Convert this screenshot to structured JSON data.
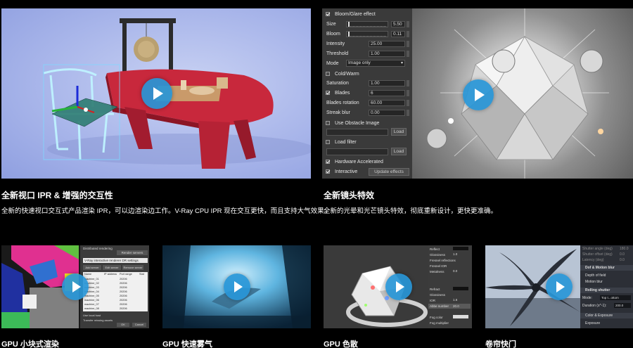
{
  "features": [
    {
      "title": "全新视口 IPR & 增强的交互性",
      "description": "全新的快速视口交互式产品渲染 IPR，可以边渲染边工作。V-Ray CPU IPR 现在交互更快，而且支持大气效果。"
    },
    {
      "title": "全新镜头特效",
      "description": "全新的光晕和光芒镜头特效，彻底重新设计，更快更准确。"
    },
    {
      "title": "GPU 小块式渲染"
    },
    {
      "title": "GPU 快速雾气"
    },
    {
      "title": "GPU 色散"
    },
    {
      "title": "卷帘快门"
    }
  ],
  "lens_panel": {
    "bloom_glare_label": "Bloom/Glare effect",
    "bloom_glare_checked": true,
    "size_label": "Size",
    "size_value": "5.50",
    "bloom_label": "Bloom",
    "bloom_value": "0.11",
    "intensity_label": "Intensity",
    "intensity_value": "25.00",
    "threshold_label": "Threshold",
    "threshold_value": "1.00",
    "mode_label": "Mode",
    "mode_value": "Image only",
    "cold_warm_label": "Cold/Warm",
    "cold_warm_checked": false,
    "saturation_label": "Saturation",
    "saturation_value": "1.00",
    "blades_label": "Blades",
    "blades_checked": true,
    "blades_value": "6",
    "blades_rotation_label": "Blades rotation",
    "blades_rotation_value": "60.00",
    "streak_blur_label": "Streak blur",
    "streak_blur_value": "0.00",
    "use_obstacle_label": "Use Obstacle Image",
    "use_obstacle_checked": false,
    "load_label": "Load",
    "load_filter_label": "Load filter",
    "load_filter_checked": false,
    "load_label_2": "Load",
    "hw_accel_label": "Hardware Accelerated",
    "hw_accel_checked": true,
    "interactive_label": "Interactive",
    "interactive_checked": true,
    "update_effects_label": "Update effects"
  },
  "bucket_panel": {
    "header": "Distributed rendering",
    "render_servers": "Render servers",
    "ipr_warn": "V-Ray interactive renderer DR settings",
    "add_server": "Add server",
    "edit_server": "Edit server",
    "remove_server": "Remove server",
    "col_name": "Name",
    "col_ip": "IP address",
    "col_port": "Port range",
    "col_stat": "Stat",
    "rows": [
      [
        "machine_01",
        "20206"
      ],
      [
        "machine_02",
        "20206"
      ],
      [
        "machine_03",
        "20206"
      ],
      [
        "machine_04",
        "20206"
      ],
      [
        "machine_05",
        "20206"
      ],
      [
        "machine_06",
        "20206"
      ],
      [
        "machine_07",
        "20206"
      ],
      [
        "machine_08",
        "20206"
      ]
    ],
    "use_local": "Use local host",
    "transfer": "Transfer missing assets",
    "ok": "OK",
    "cancel": "Cancel"
  },
  "dispersion_panel": {
    "reflect": "Reflect",
    "glossiness": "Glossiness",
    "fresnel": "Fresnel reflections",
    "fresnel_ior": "Fresnel IOR",
    "metalness": "Metalness",
    "refract": "Refract",
    "glossiness2": "Glossiness",
    "ior": "IOR",
    "abbe": "Abbe number",
    "abbe_value": "20.0",
    "fog_color": "Fog color",
    "fog_mult": "Fog multiplier",
    "v1": "1.0",
    "v2": "1.6",
    "v3": "0.0"
  },
  "shutter_panel": {
    "top_lines": [
      "Shutter angle (deg)",
      "Shutter offset (deg)",
      "Latency (deg)"
    ],
    "top_values": [
      "180.0",
      "0.0",
      "0.0"
    ],
    "dof_header": "Dof & Motion blur",
    "depth_of_field": "Depth of field",
    "motion_blur": "Motion blur",
    "rolling_header": "Rolling shutter",
    "mode_label": "Mode:",
    "mode_value": "Top t...ottom",
    "duration_label": "Duration (s^-1):",
    "duration_value": "200.0",
    "color_header": "Color & Exposure",
    "exposure": "Exposure"
  },
  "colors": {
    "accent_play": "#2896d7",
    "background": "#000000",
    "panel_bg": "#3a3a3a",
    "table_red": "#c8283c"
  }
}
